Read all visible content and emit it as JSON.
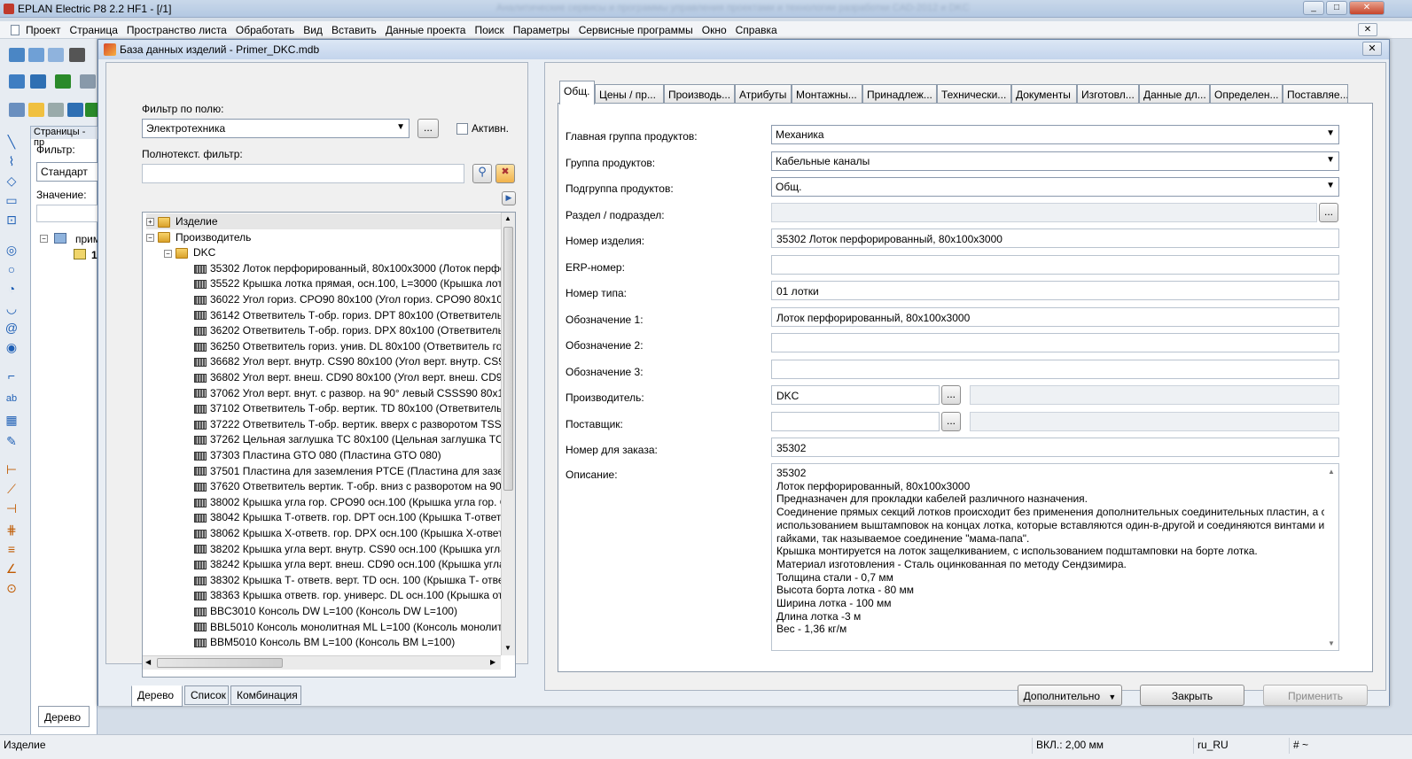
{
  "app": {
    "title": "EPLAN Electric P8 2.2 HF1 - [/1]",
    "blurred_title": "Аналитические сервисы и программы управления проектами и технологии разработки CAD-2012 и DKC",
    "min": "_",
    "max": "□",
    "close": "✕"
  },
  "menu": [
    "Проект",
    "Страница",
    "Пространство листа",
    "Обработать",
    "Вид",
    "Вставить",
    "Данные проекта",
    "Поиск",
    "Параметры",
    "Сервисные программы",
    "Окно",
    "Справка"
  ],
  "left_panel": {
    "header": "Страницы - пр",
    "filter_label": "Фильтр:",
    "filter_value": "Стандарт",
    "value_label": "Значение:",
    "tree_root": "прим",
    "tree_child": "1",
    "bottom_tab": "Дерево"
  },
  "dialog": {
    "title": "База данных изделий - Primer_DKC.mdb",
    "close": "✕",
    "field_filter_label": "Фильтр по полю:",
    "field_filter_value": "Электротехника",
    "browse_label": "...",
    "active_label": "Активн.",
    "fulltext_label": "Полнотекст. фильтр:",
    "fulltext_value": "",
    "tree": {
      "root_items": [
        {
          "label": "Изделие",
          "expander": "+"
        },
        {
          "label": "Производитель",
          "expander": "−"
        }
      ],
      "manufacturer": "DKC",
      "parts": [
        "35302 Лоток перфорированный, 80x100x3000 (Лоток перфор",
        "35522 Крышка лотка прямая, осн.100, L=3000 (Крышка лотк",
        "36022 Угол гориз. CPO90 80x100 (Угол гориз. CPO90 80x100)",
        "36142 Ответвитель Т-обр. гориз. DPT 80x100 (Ответвитель Т-",
        "36202 Ответвитель Т-обр. гориз. DPX 80x100 (Ответвитель Т-",
        "36250 Ответвитель гориз. унив. DL 80x100 (Ответвитель гори",
        "36682 Угол верт. внутр. CS90 80x100 (Угол верт. внутр. CS90 8",
        "36802 Угол верт. внеш. CD90 80x100 (Угол верт. внеш. CD90 8",
        "37062 Угол верт. внут. с развор. на 90° левый CSSS90 80x100",
        "37102 Ответвитель Т-обр. вертик. TD 80x100 (Ответвитель Т-",
        "37222 Ответвитель Т-обр. вертик. вверх с разворотом TSS 80",
        "37262 Цельная заглушка TC 80x100 (Цельная заглушка TC 8",
        "37303 Пластина GTO 080 (Пластина GTO 080)",
        "37501 Пластина для заземления PTCE (Пластина для заземл",
        "37620 Ответвитель вертик. Т-обр. вниз с разворотом на 90°",
        "38002 Крышка угла гор. CPO90 осн.100 (Крышка угла гор. C",
        "38042 Крышка Т-ответв. гор. DPT осн.100 (Крышка Т-ответв",
        "38062 Крышка Х-ответв. гор. DPX осн.100 (Крышка Х-ответв",
        "38202 Крышка угла верт. внутр. CS90 осн.100 (Крышка угла",
        "38242 Крышка угла верт. внеш. CD90 осн.100 (Крышка угла",
        "38302 Крышка Т- ответв. верт. TD осн. 100 (Крышка Т- ответ",
        "38363 Крышка ответв. гор. универс. DL осн.100 (Крышка от",
        "BBC3010 Консоль  DW L=100 (Консоль  DW L=100)",
        "BBL5010 Консоль монолитная ML L=100 (Консоль монолитн",
        "BBM5010 Консоль BM L=100 (Консоль BM L=100)"
      ]
    },
    "bottom_tabs": [
      "Дерево",
      "Список",
      "Комбинация"
    ],
    "tabs": [
      "Общ.",
      "Цены / пр...",
      "Производь...",
      "Атрибуты",
      "Монтажны...",
      "Принадлеж...",
      "Технически...",
      "Документы",
      "Изготовл...",
      "Данные дл...",
      "Определен...",
      "Поставляе..."
    ],
    "form": {
      "main_group_label": "Главная группа продуктов:",
      "main_group_value": "Механика",
      "group_label": "Группа продуктов:",
      "group_value": "Кабельные каналы",
      "subgroup_label": "Подгруппа продуктов:",
      "subgroup_value": "Общ.",
      "section_label": "Раздел / подраздел:",
      "section_value": "",
      "part_number_label": "Номер изделия:",
      "part_number_value": "35302 Лоток перфорированный, 80x100x3000",
      "erp_label": "ERP-номер:",
      "erp_value": "",
      "type_number_label": "Номер типа:",
      "type_number_value": "01 лотки",
      "designation1_label": "Обозначение 1:",
      "designation1_value": "Лоток перфорированный, 80x100x3000",
      "designation2_label": "Обозначение 2:",
      "designation2_value": "",
      "designation3_label": "Обозначение 3:",
      "designation3_value": "",
      "manufacturer_label": "Производитель:",
      "manufacturer_value": "DKC",
      "supplier_label": "Поставщик:",
      "supplier_value": "",
      "order_number_label": "Номер для заказа:",
      "order_number_value": "35302",
      "description_label": "Описание:",
      "description_lines": [
        "35302",
        "Лоток перфорированный, 80x100x3000",
        "Предназначен для прокладки кабелей различного назначения.",
        "Соединение прямых секций лотков происходит без применения дополнительных соединительных пластин, а с",
        "использованием выштамповок на концах лотка, которые вставляются один-в-другой и соединяются винтами и",
        "гайками, так называемое соединение \"мама-папа\".",
        "Крышка монтируется на лоток защелкиванием, с использованием подштамповки на борте лотка.",
        "Материал изготовления - Сталь оцинкованная по методу Сендзимира.",
        "Толщина стали - 0,7 мм",
        "Высота борта лотка - 80 мм",
        "Ширина лотка - 100 мм",
        "Длина лотка -3 м",
        "Вес - 1,36 кг/м"
      ]
    },
    "buttons": {
      "extra": "Дополнительно",
      "close": "Закрыть",
      "apply": "Применить"
    },
    "supplier_mask_color": "#0a8a0a"
  },
  "statusbar": {
    "left": "Изделие",
    "grid": "ВКЛ.: 2,00 мм",
    "locale": "ru_RU",
    "mode": "# ~"
  }
}
